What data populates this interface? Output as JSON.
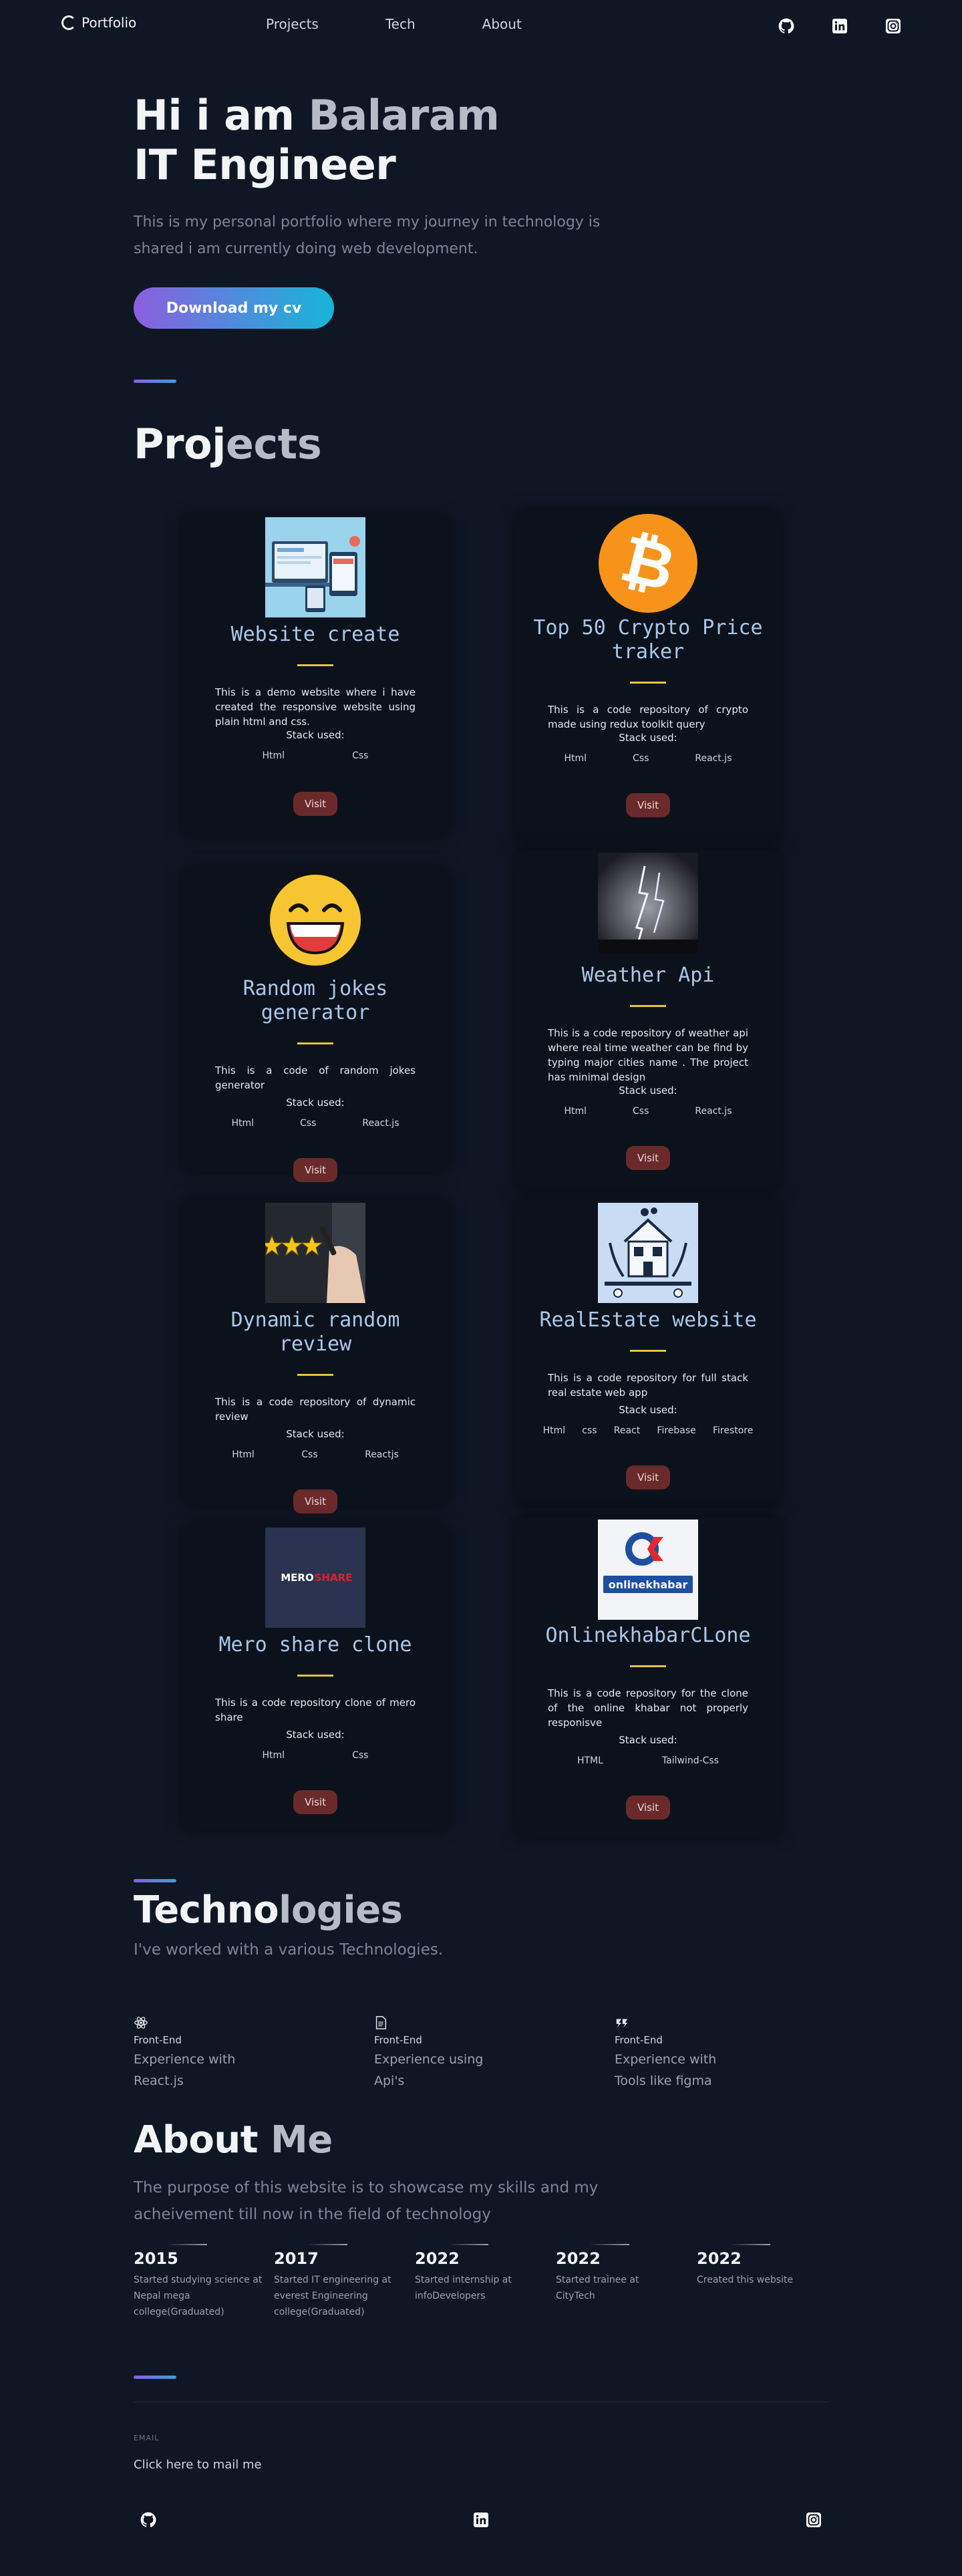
{
  "nav": {
    "brand": "Portfolio",
    "links": [
      "Projects",
      "Tech",
      "About"
    ],
    "icons": [
      "github-icon",
      "linkedin-icon",
      "instagram-icon"
    ]
  },
  "hero": {
    "line1_a": "Hi i am ",
    "line1_b": "Balaram",
    "line2": "IT Engineer",
    "subtitle": "This is my personal portfolio where my journey in technology is shared i am currently doing web development.",
    "cv_button": "Download my cv"
  },
  "projects": {
    "title_a": "Proj",
    "title_b": "ects",
    "stack_label": "Stack used:",
    "visit_label": "Visit",
    "items": [
      {
        "title": "Website create",
        "desc": "This is a demo website where i have created the responsive website using plain html and css.",
        "stack": [
          "Html",
          "Css"
        ]
      },
      {
        "title": "Top 50 Crypto Price traker",
        "desc": "This is a code repository of crypto made using redux toolkit query",
        "stack": [
          "Html",
          "Css",
          "React.js"
        ]
      },
      {
        "title": "Random jokes generator",
        "desc": "This is a code of random jokes generator",
        "stack": [
          "Html",
          "Css",
          "React.js"
        ]
      },
      {
        "title": "Weather Api",
        "desc": "This is a code repository of weather api where real time weather can be find by typing major cities name . The project has minimal design",
        "stack": [
          "Html",
          "Css",
          "React.js"
        ]
      },
      {
        "title": "Dynamic random review",
        "desc": "This is a code repository of dynamic review",
        "stack": [
          "Html",
          "Css",
          "Reactjs"
        ]
      },
      {
        "title": "RealEstate website",
        "desc": "This is a code repository for full stack real estate web app",
        "stack": [
          "Html",
          "css",
          "React",
          "Firebase",
          "Firestore"
        ]
      },
      {
        "title": "Mero share clone",
        "desc": "This is a code repository clone of mero share",
        "stack": [
          "Html",
          "Css"
        ]
      },
      {
        "title": "OnlinekhabarCLone",
        "desc": "This is a code repository for the clone of the online khabar not properly responisve",
        "stack": [
          "HTML",
          "Tailwind-Css"
        ]
      }
    ],
    "image_texts": {
      "meroshare": [
        "MERO",
        "SHARE"
      ],
      "onlinekhabar": "onlinekhabar"
    }
  },
  "tech": {
    "title_a": "Techno",
    "title_b": "logies",
    "subtitle": "I've worked with a various Technologies.",
    "items": [
      {
        "icon": "react-icon",
        "category": "Front-End",
        "desc": "Experience with React.js"
      },
      {
        "icon": "api-file-icon",
        "category": "Front-End",
        "desc": "Experience using Api's"
      },
      {
        "icon": "figma-icon",
        "category": "Front-End",
        "desc": "Experience with Tools like figma"
      }
    ]
  },
  "about": {
    "title_a": "About ",
    "title_b": "Me",
    "subtitle": "The purpose of this website is to showcase my skills and my acheivement till now in the field of technology",
    "timeline": [
      {
        "year": "2015",
        "desc": "Started studying science at Nepal mega college(Graduated)"
      },
      {
        "year": "2017",
        "desc": "Started IT engineering at everest Engineering college(Graduated)"
      },
      {
        "year": "2022",
        "desc": "Started internship at infoDevelopers"
      },
      {
        "year": "2022",
        "desc": "Started trainee at CityTech"
      },
      {
        "year": "2022",
        "desc": "Created this website"
      }
    ]
  },
  "footer": {
    "email_label": "EMAIL",
    "mail_link": "Click here to mail me",
    "icons": [
      "github-icon",
      "linkedin-icon",
      "instagram-icon"
    ]
  },
  "colors": {
    "background": "#0f1724",
    "card": "#0c121c",
    "accent_start": "#8b5fe0",
    "accent_end": "#17b6d8",
    "title_blue": "#a8c8e8",
    "divider_yellow": "#e2c341",
    "visit_button": "#6b2a2a"
  }
}
